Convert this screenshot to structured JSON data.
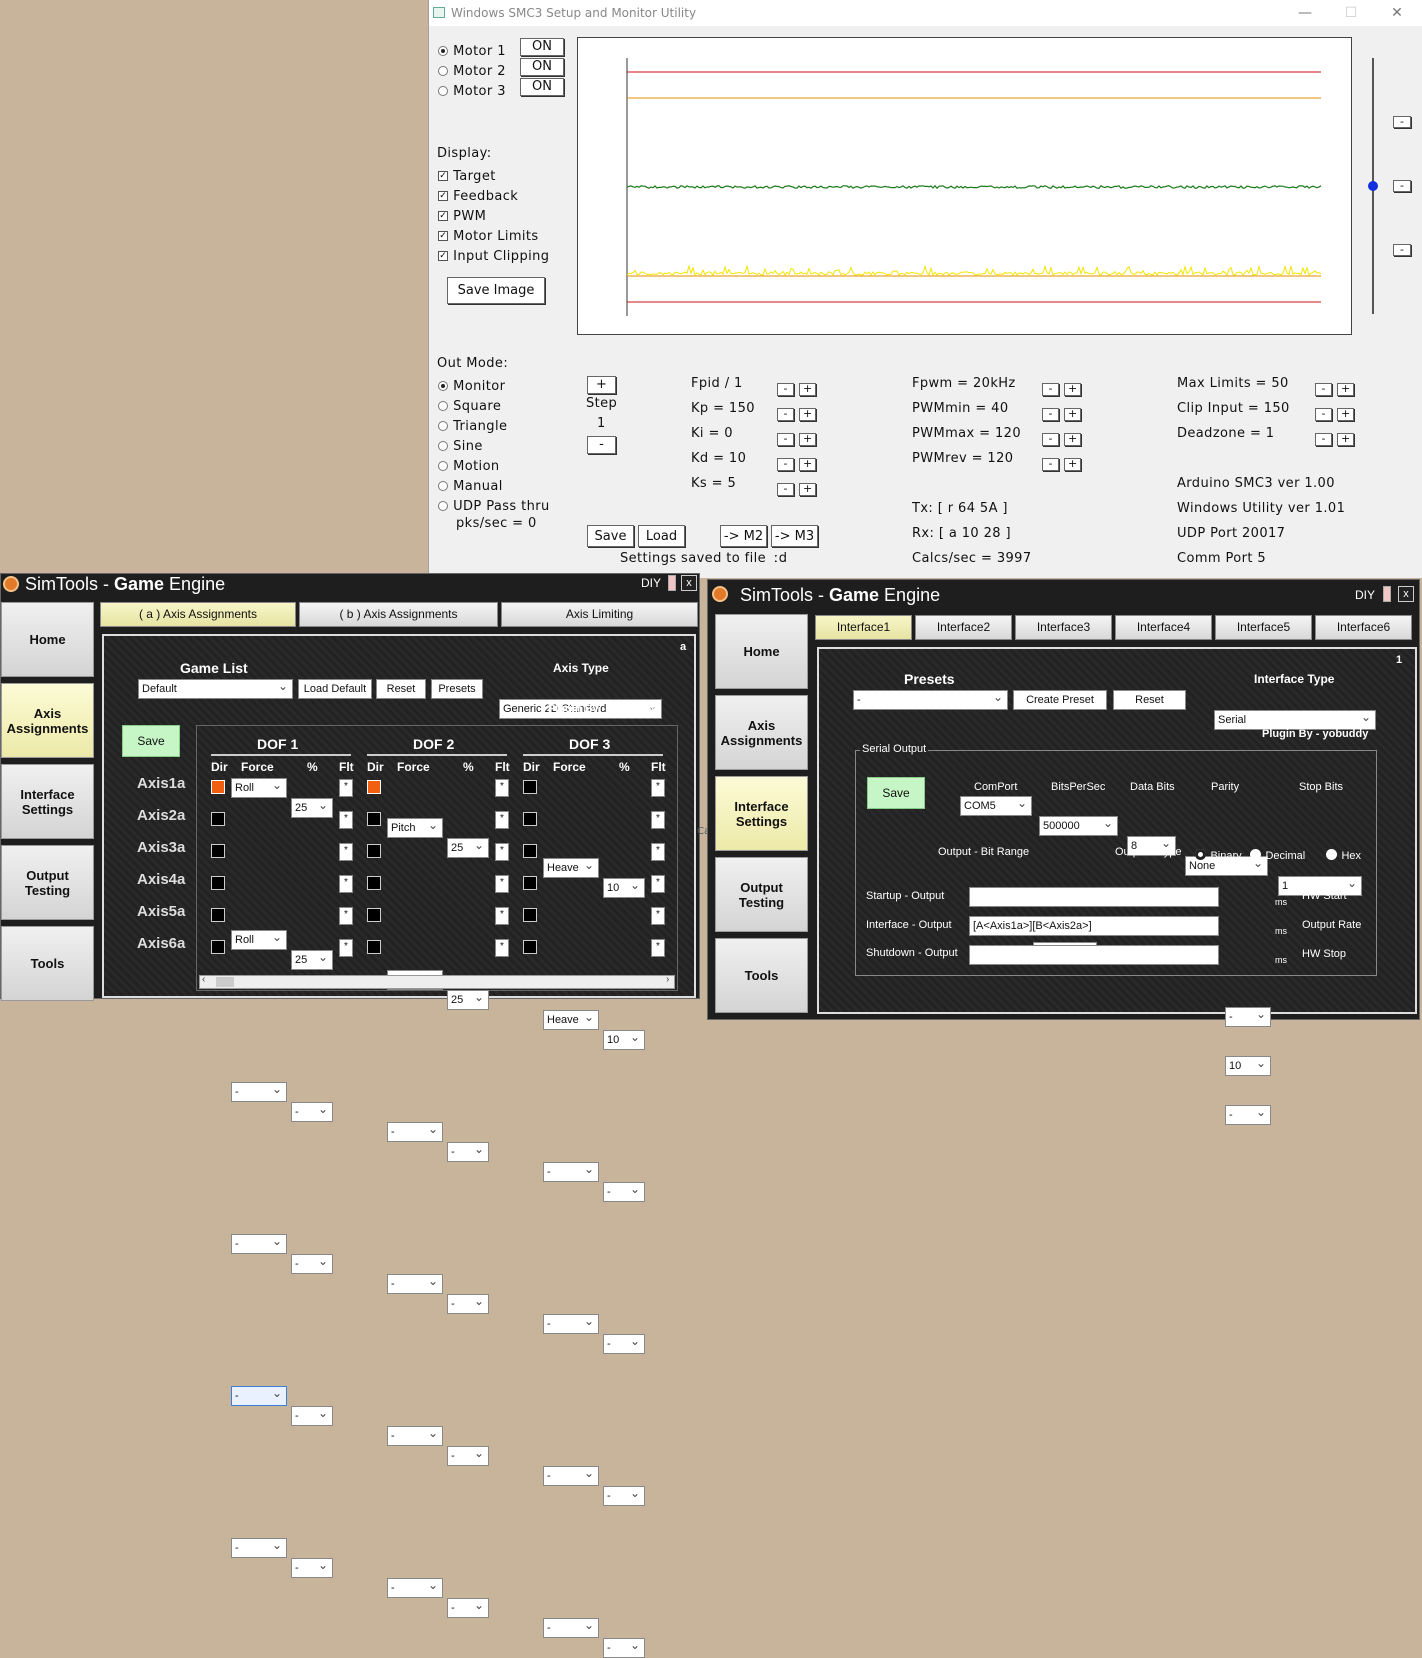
{
  "smc": {
    "title": "Windows SMC3 Setup and Monitor Utility",
    "window_controls": [
      "—",
      "☐",
      "✕"
    ],
    "motors": [
      {
        "label": "Motor 1",
        "btn": "ON",
        "selected": true
      },
      {
        "label": "Motor 2",
        "btn": "ON",
        "selected": false
      },
      {
        "label": "Motor 3",
        "btn": "ON",
        "selected": false
      }
    ],
    "display_label": "Display:",
    "display_items": [
      "Target",
      "Feedback",
      "PWM",
      "Motor Limits",
      "Input Clipping"
    ],
    "save_image": "Save Image",
    "out_mode_label": "Out Mode:",
    "out_modes": [
      {
        "label": "Monitor",
        "selected": true
      },
      {
        "label": "Square",
        "selected": false
      },
      {
        "label": "Triangle",
        "selected": false
      },
      {
        "label": "Sine",
        "selected": false
      },
      {
        "label": "Motion",
        "selected": false
      },
      {
        "label": "Manual",
        "selected": false
      },
      {
        "label": "UDP Pass thru",
        "selected": false
      }
    ],
    "pks": "pks/sec = 0",
    "step_plus": "+",
    "step_label": "Step",
    "step_value": "1",
    "step_minus": "-",
    "pid_params": [
      "Fpid / 1",
      "Kp = 150",
      "Ki = 0",
      "Kd = 10",
      "Ks = 5"
    ],
    "pwm_params": [
      "Fpwm = 20kHz",
      "PWMmin = 40",
      "PWMmax = 120",
      "PWMrev = 120"
    ],
    "limit_params": [
      "Max Limits = 50",
      "Clip Input = 150",
      "Deadzone = 1"
    ],
    "minus": "-",
    "plus": "+",
    "tx": "Tx: [ r 64 5A ]",
    "rx": "Rx: [ a 10 28 ]",
    "calcs": "Calcs/sec = 3997",
    "versions": [
      "Arduino SMC3 ver 1.00",
      "Windows Utility ver 1.01",
      "UDP Port 20017",
      "Comm Port 5"
    ],
    "save_btn": "Save",
    "load_btn": "Load",
    "m2_btn": "-> M2",
    "m3_btn": "-> M3",
    "status": "Settings saved to file",
    "status_tail": "ːd",
    "side_buttons": [
      "-",
      "-",
      "-"
    ],
    "chart_colors": {
      "limit": "#d01010",
      "clip": "#e08c00",
      "feedback": "#1a7a1a",
      "pwm": "#f2e600"
    }
  },
  "sim1": {
    "title_pre": "SimTools - ",
    "title_game": "Game",
    "title_post": " Engine",
    "diy": "DIY",
    "close": "x",
    "nav": [
      "Home",
      "Axis Assignments",
      "Interface Settings",
      "Output Testing",
      "Tools"
    ],
    "tabs": [
      "( a ) Axis Assignments",
      "( b ) Axis Assignments",
      "Axis Limiting"
    ],
    "corner": "a",
    "game_list": "Game List",
    "game_value": "Default",
    "load_default": "Load Default",
    "reset": "Reset",
    "presets": "Presets",
    "axis_type": "Axis Type",
    "axis_type_value": "Generic 2D Standard",
    "plugin": "Plugin By - yobuddy",
    "save": "Save",
    "dofs": [
      "DOF 1",
      "DOF 2",
      "DOF 3"
    ],
    "col_dir": "Dir",
    "col_force": "Force",
    "col_pct": "%",
    "col_flt": "Flt",
    "flt_mark": "*",
    "axes": [
      {
        "name": "Axis1a",
        "cells": [
          {
            "dir": true,
            "force": "Roll",
            "pct": "25"
          },
          {
            "dir": true,
            "force": "Pitch",
            "pct": "25"
          },
          {
            "dir": false,
            "force": "Heave",
            "pct": "10"
          }
        ]
      },
      {
        "name": "Axis2a",
        "cells": [
          {
            "dir": false,
            "force": "Roll",
            "pct": "25"
          },
          {
            "dir": false,
            "force": "Pitch",
            "pct": "25"
          },
          {
            "dir": false,
            "force": "Heave",
            "pct": "10"
          }
        ]
      },
      {
        "name": "Axis3a",
        "cells": [
          {
            "dir": false,
            "force": "-",
            "pct": "-"
          },
          {
            "dir": false,
            "force": "-",
            "pct": "-"
          },
          {
            "dir": false,
            "force": "-",
            "pct": "-"
          }
        ]
      },
      {
        "name": "Axis4a",
        "cells": [
          {
            "dir": false,
            "force": "-",
            "pct": "-"
          },
          {
            "dir": false,
            "force": "-",
            "pct": "-"
          },
          {
            "dir": false,
            "force": "-",
            "pct": "-"
          }
        ]
      },
      {
        "name": "Axis5a",
        "cells": [
          {
            "dir": false,
            "force": "-",
            "pct": "-"
          },
          {
            "dir": false,
            "force": "-",
            "pct": "-"
          },
          {
            "dir": false,
            "force": "-",
            "pct": "-"
          }
        ]
      },
      {
        "name": "Axis6a",
        "cells": [
          {
            "dir": false,
            "force": "-",
            "pct": "-"
          },
          {
            "dir": false,
            "force": "-",
            "pct": "-"
          },
          {
            "dir": false,
            "force": "-",
            "pct": "-"
          }
        ]
      }
    ]
  },
  "sim2": {
    "title_pre": "SimTools - ",
    "title_game": "Game",
    "title_post": " Engine",
    "diy": "DIY",
    "close": "x",
    "nav": [
      "Home",
      "Axis Assignments",
      "Interface Settings",
      "Output Testing",
      "Tools"
    ],
    "tabs": [
      "Interface1",
      "Interface2",
      "Interface3",
      "Interface4",
      "Interface5",
      "Interface6"
    ],
    "corner": "1",
    "presets": "Presets",
    "preset_value": "-",
    "create_preset": "Create Preset",
    "reset": "Reset",
    "interface_type": "Interface Type",
    "interface_value": "Serial",
    "plugin": "Plugin By - yobuddy",
    "serial_output": "Serial Output",
    "save": "Save",
    "comport": "ComPort",
    "comport_val": "COM5",
    "bps": "BitsPerSec",
    "bps_val": "500000",
    "databits": "Data Bits",
    "databits_val": "8",
    "parity": "Parity",
    "parity_val": "None",
    "stopbits": "Stop Bits",
    "stopbits_val": "1",
    "bit_range": "Output - Bit Range",
    "bit_range_val": "10",
    "out_type": "Output - Type",
    "binary": "Binary",
    "decimal": "Decimal",
    "hex": "Hex",
    "startup": "Startup - Output",
    "startup_val": "",
    "startup_ms": "-",
    "ms": "ms",
    "hw_start": "HW Start",
    "interface_out": "Interface - Output",
    "interface_out_val": "[A<Axis1a>][B<Axis2a>]",
    "interface_ms": "10",
    "output_rate": "Output Rate",
    "shutdown": "Shutdown - Output",
    "shutdown_val": "",
    "shutdown_ms": "-",
    "hw_stop": "HW Stop"
  },
  "stray_text": "Ca"
}
